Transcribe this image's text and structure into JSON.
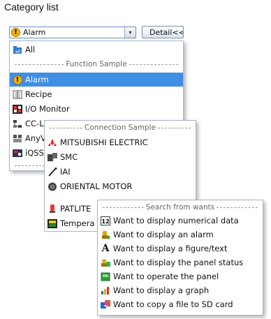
{
  "caption": "Category list",
  "combo": {
    "value": "Alarm",
    "dropdown_glyph": "▾"
  },
  "detail_button": "Detail<<",
  "category_list": {
    "all": "All",
    "function_header": "Function Sample",
    "function_items": [
      "Alarm",
      "Recipe",
      "I/O Monitor",
      "CC-L",
      "AnyV",
      "iQSS"
    ],
    "selected": "Alarm"
  },
  "connection_list": {
    "header": "Connection Sample",
    "items": [
      "MITSUBISHI ELECTRIC",
      "SMC",
      "IAI",
      "ORIENTAL MOTOR",
      "PATLITE",
      "Tempera"
    ]
  },
  "wants_list": {
    "header": "Search from wants",
    "items": [
      "Want to display numerical data",
      "Want to display an alarm",
      "Want to display a figure/text",
      "Want to display the panel status",
      "Want to operate the panel",
      "Want to display a graph",
      "Want to copy a file to SD card"
    ]
  },
  "colors": {
    "selection": "#3d8ee4",
    "border": "#a9b7c9"
  }
}
